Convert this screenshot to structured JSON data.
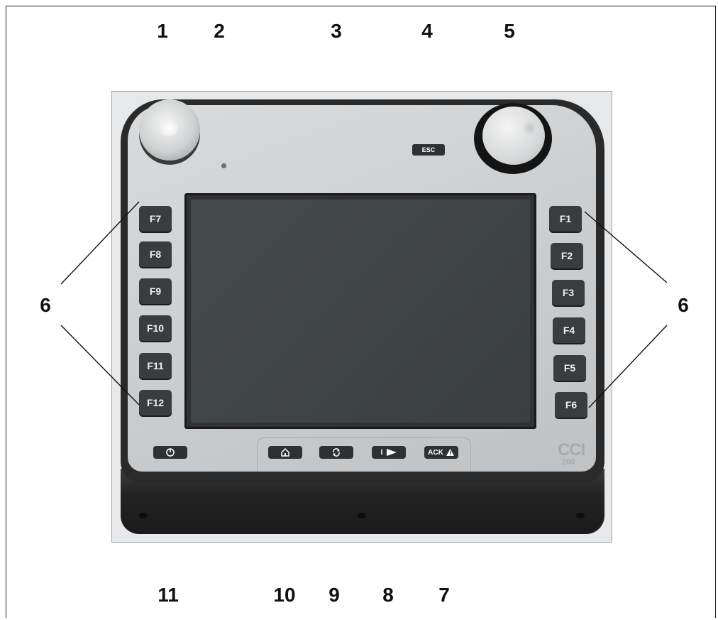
{
  "callouts": {
    "top": [
      "1",
      "2",
      "3",
      "4",
      "5"
    ],
    "side_left": "6",
    "side_right": "6",
    "bottom": [
      "11",
      "10",
      "9",
      "8",
      "7"
    ]
  },
  "device": {
    "esc_label": "ESC",
    "left_keys": [
      "F7",
      "F8",
      "F9",
      "F10",
      "F11",
      "F12"
    ],
    "right_keys": [
      "F1",
      "F2",
      "F3",
      "F4",
      "F5",
      "F6"
    ],
    "ack_label": "ACK",
    "info_label": "i",
    "brand": "CCI",
    "model": "200"
  },
  "icons": [
    "power-icon",
    "home-icon",
    "refresh-icon",
    "info-play-icon",
    "warning-icon"
  ],
  "colors": {
    "key": "#3a3d3e",
    "face": "#c9ccce",
    "shell": "#2a2a2a",
    "screen": "#3b3f40"
  }
}
